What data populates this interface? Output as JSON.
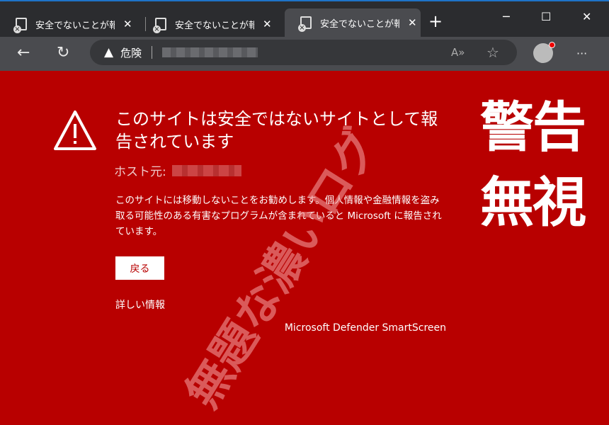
{
  "tabs": [
    {
      "title": "安全でないことが報告されています"
    },
    {
      "title": "安全でないことが報告されています"
    },
    {
      "title": "安全でないことが報告されています",
      "active": true
    }
  ],
  "window": {
    "new_tab": "+",
    "minimize": "─",
    "maximize": "☐",
    "close": "✕"
  },
  "toolbar": {
    "back": "←",
    "refresh": "↻",
    "security_label": "危険",
    "read_aloud": "A»",
    "favorite": "☆",
    "more": "···"
  },
  "page": {
    "title": "このサイトは安全ではないサイトとして報告されています",
    "host_label": "ホスト元:",
    "body": "このサイトには移動しないことをお勧めします。個人情報や金融情報を盗み取る可能性のある有害なプログラムが含まれていると Microsoft に報告されています。",
    "back_button": "戻る",
    "details_link": "詳しい情報",
    "brand": "Microsoft Defender SmartScreen"
  },
  "overlay": {
    "line1": "警告",
    "line2": "無視",
    "watermark": "無題な濃いログ"
  },
  "colors": {
    "danger": "#b80000",
    "tabstrip": "#2b2c2f",
    "toolbar": "#4a4b4f"
  }
}
